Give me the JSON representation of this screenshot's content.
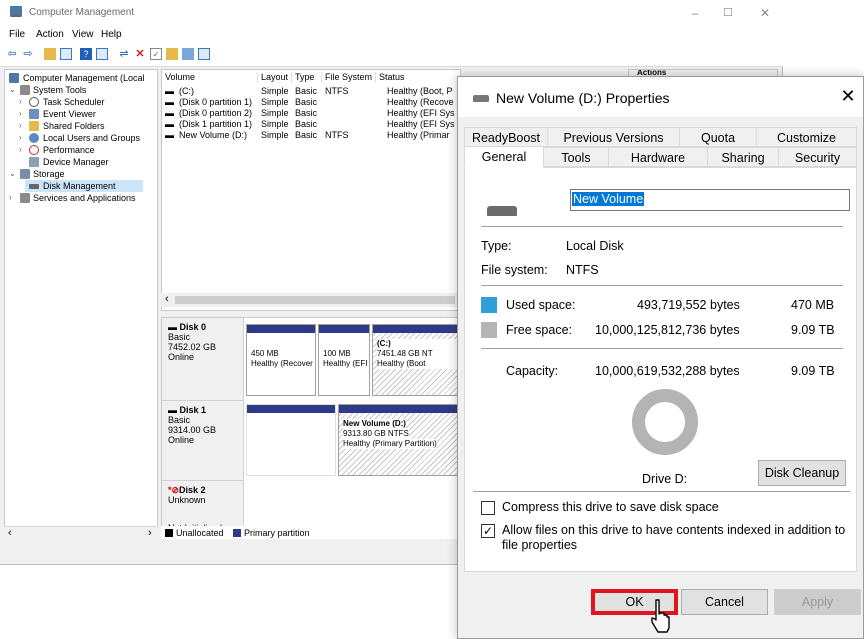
{
  "cm": {
    "title": "Computer Management",
    "menu": [
      "File",
      "Action",
      "View",
      "Help"
    ],
    "window_controls": {
      "minimize": "–",
      "maximize": "☐",
      "close": "✕"
    }
  },
  "tree": {
    "items": [
      {
        "label": "Computer Management (Local"
      },
      {
        "label": "System Tools"
      },
      {
        "label": "Task Scheduler"
      },
      {
        "label": "Event Viewer"
      },
      {
        "label": "Shared Folders"
      },
      {
        "label": "Local Users and Groups"
      },
      {
        "label": "Performance"
      },
      {
        "label": "Device Manager"
      },
      {
        "label": "Storage"
      },
      {
        "label": "Disk Management"
      },
      {
        "label": "Services and Applications"
      }
    ],
    "scroll_left": "‹",
    "scroll_right": "›"
  },
  "volumes": {
    "headers": [
      "Volume",
      "Layout",
      "Type",
      "File System",
      "Status"
    ],
    "rows": [
      {
        "volume": "(C:)",
        "layout": "Simple",
        "type": "Basic",
        "fs": "NTFS",
        "status": "Healthy (Boot, P"
      },
      {
        "volume": "(Disk 0 partition 1)",
        "layout": "Simple",
        "type": "Basic",
        "fs": "",
        "status": "Healthy (Recove"
      },
      {
        "volume": "(Disk 0 partition 2)",
        "layout": "Simple",
        "type": "Basic",
        "fs": "",
        "status": "Healthy (EFI Sys"
      },
      {
        "volume": "(Disk 1 partition 1)",
        "layout": "Simple",
        "type": "Basic",
        "fs": "",
        "status": "Healthy (EFI Sys"
      },
      {
        "volume": "New Volume (D:)",
        "layout": "Simple",
        "type": "Basic",
        "fs": "NTFS",
        "status": "Healthy (Primar"
      }
    ],
    "scroll_left": "‹"
  },
  "disks": [
    {
      "name": "Disk 0",
      "kind": "Basic",
      "size": "7452.02 GB",
      "state": "Online",
      "parts": [
        {
          "l1": "",
          "l2": "450 MB",
          "l3": "Healthy (Recover"
        },
        {
          "l1": "",
          "l2": "100 MB",
          "l3": "Healthy (EFI"
        },
        {
          "l1": "(C:)",
          "l2": "7451.48 GB NT",
          "l3": "Healthy (Boot"
        }
      ]
    },
    {
      "name": "Disk 1",
      "kind": "Basic",
      "size": "9314.00 GB",
      "state": "Online",
      "parts": [
        {
          "l1": "New Volume (D:)",
          "l2": "9313.80 GB NTFS",
          "l3": "Healthy (Primary Partition)"
        }
      ]
    },
    {
      "name": "Disk 2",
      "kind": "Unknown",
      "size": "Not Initialized",
      "state": ""
    }
  ],
  "legend": {
    "unallocated": "Unallocated",
    "primary": "Primary partition"
  },
  "actions_header": "Actions",
  "dialog": {
    "title": "New Volume (D:) Properties",
    "close": "✕",
    "tabs_row1": [
      "ReadyBoost",
      "Previous Versions",
      "Quota",
      "Customize"
    ],
    "tabs_row2": [
      "General",
      "Tools",
      "Hardware",
      "Sharing",
      "Security"
    ],
    "active_tab": "General",
    "volume_name": "New Volume",
    "type_label": "Type:",
    "type_value": "Local Disk",
    "fs_label": "File system:",
    "fs_value": "NTFS",
    "used_label": "Used space:",
    "used_bytes": "493,719,552 bytes",
    "used_size": "470 MB",
    "free_label": "Free space:",
    "free_bytes": "10,000,125,812,736 bytes",
    "free_size": "9.09 TB",
    "cap_label": "Capacity:",
    "cap_bytes": "10,000,619,532,288 bytes",
    "cap_size": "9.09 TB",
    "drive_label": "Drive D:",
    "cleanup": "Disk Cleanup",
    "compress_label": "Compress this drive to save disk space",
    "compress_checked": false,
    "index_label_1": "Allow files on this drive to have contents indexed in addition to",
    "index_label_2": "file properties",
    "index_checked": true,
    "ok": "OK",
    "cancel": "Cancel",
    "apply": "Apply"
  },
  "colors": {
    "used": "#2e9fd8",
    "free": "#b4b4b4",
    "partition_header": "#2e3a87",
    "ok_highlight": "#e0151e",
    "selection": "#0078d7"
  }
}
